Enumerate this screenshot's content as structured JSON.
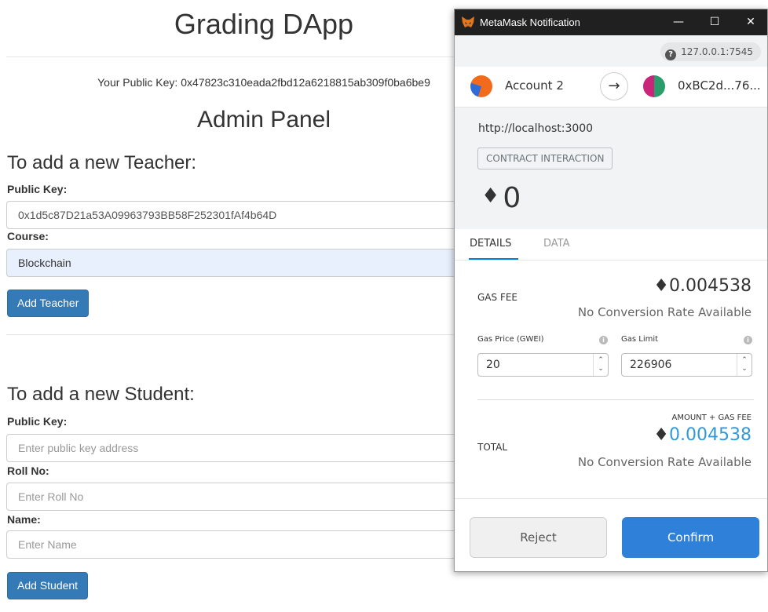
{
  "dapp": {
    "title": "Grading DApp",
    "public_key_line": "Your Public Key: 0x47823c310eada2fbd12a6218815ab309f0ba6be9",
    "admin_title": "Admin Panel",
    "teacher_section": {
      "heading": "To add a new Teacher:",
      "public_key_label": "Public Key:",
      "public_key_value": "0x1d5c87D21a53A09963793BB58F252301fAf4b64D",
      "course_label": "Course:",
      "course_value": "Blockchain",
      "add_button": "Add Teacher"
    },
    "student_section": {
      "heading": "To add a new Student:",
      "public_key_label": "Public Key:",
      "public_key_placeholder": "Enter public key address",
      "roll_label": "Roll No:",
      "roll_placeholder": "Enter Roll No",
      "name_label": "Name:",
      "name_placeholder": "Enter Name",
      "add_button": "Add Student"
    }
  },
  "metamask": {
    "window_title": "MetaMask Notification",
    "window_controls": {
      "minimize": "—",
      "maximize": "☐",
      "close": "✕"
    },
    "rpc_url": "127.0.0.1:7545",
    "from_account": "Account 2",
    "to_account": "0xBC2d...76...",
    "origin": "http://localhost:3000",
    "badge": "CONTRACT INTERACTION",
    "eth_amount": "0",
    "eth_glyph": "♦",
    "tabs": {
      "details": "DETAILS",
      "data": "DATA"
    },
    "gas_fee": {
      "label": "GAS FEE",
      "value": "0.004538",
      "conversion": "No Conversion Rate Available"
    },
    "gas_price_label": "Gas Price (GWEI)",
    "gas_price_value": "20",
    "gas_limit_label": "Gas Limit",
    "gas_limit_value": "226906",
    "amount_gas_label": "AMOUNT + GAS FEE",
    "total": {
      "label": "TOTAL",
      "value": "0.004538",
      "conversion": "No Conversion Rate Available"
    },
    "reject_label": "Reject",
    "confirm_label": "Confirm",
    "colors": {
      "accent": "#2f80d8",
      "total_blue": "#3098dc",
      "titlebar": "#202020"
    }
  }
}
